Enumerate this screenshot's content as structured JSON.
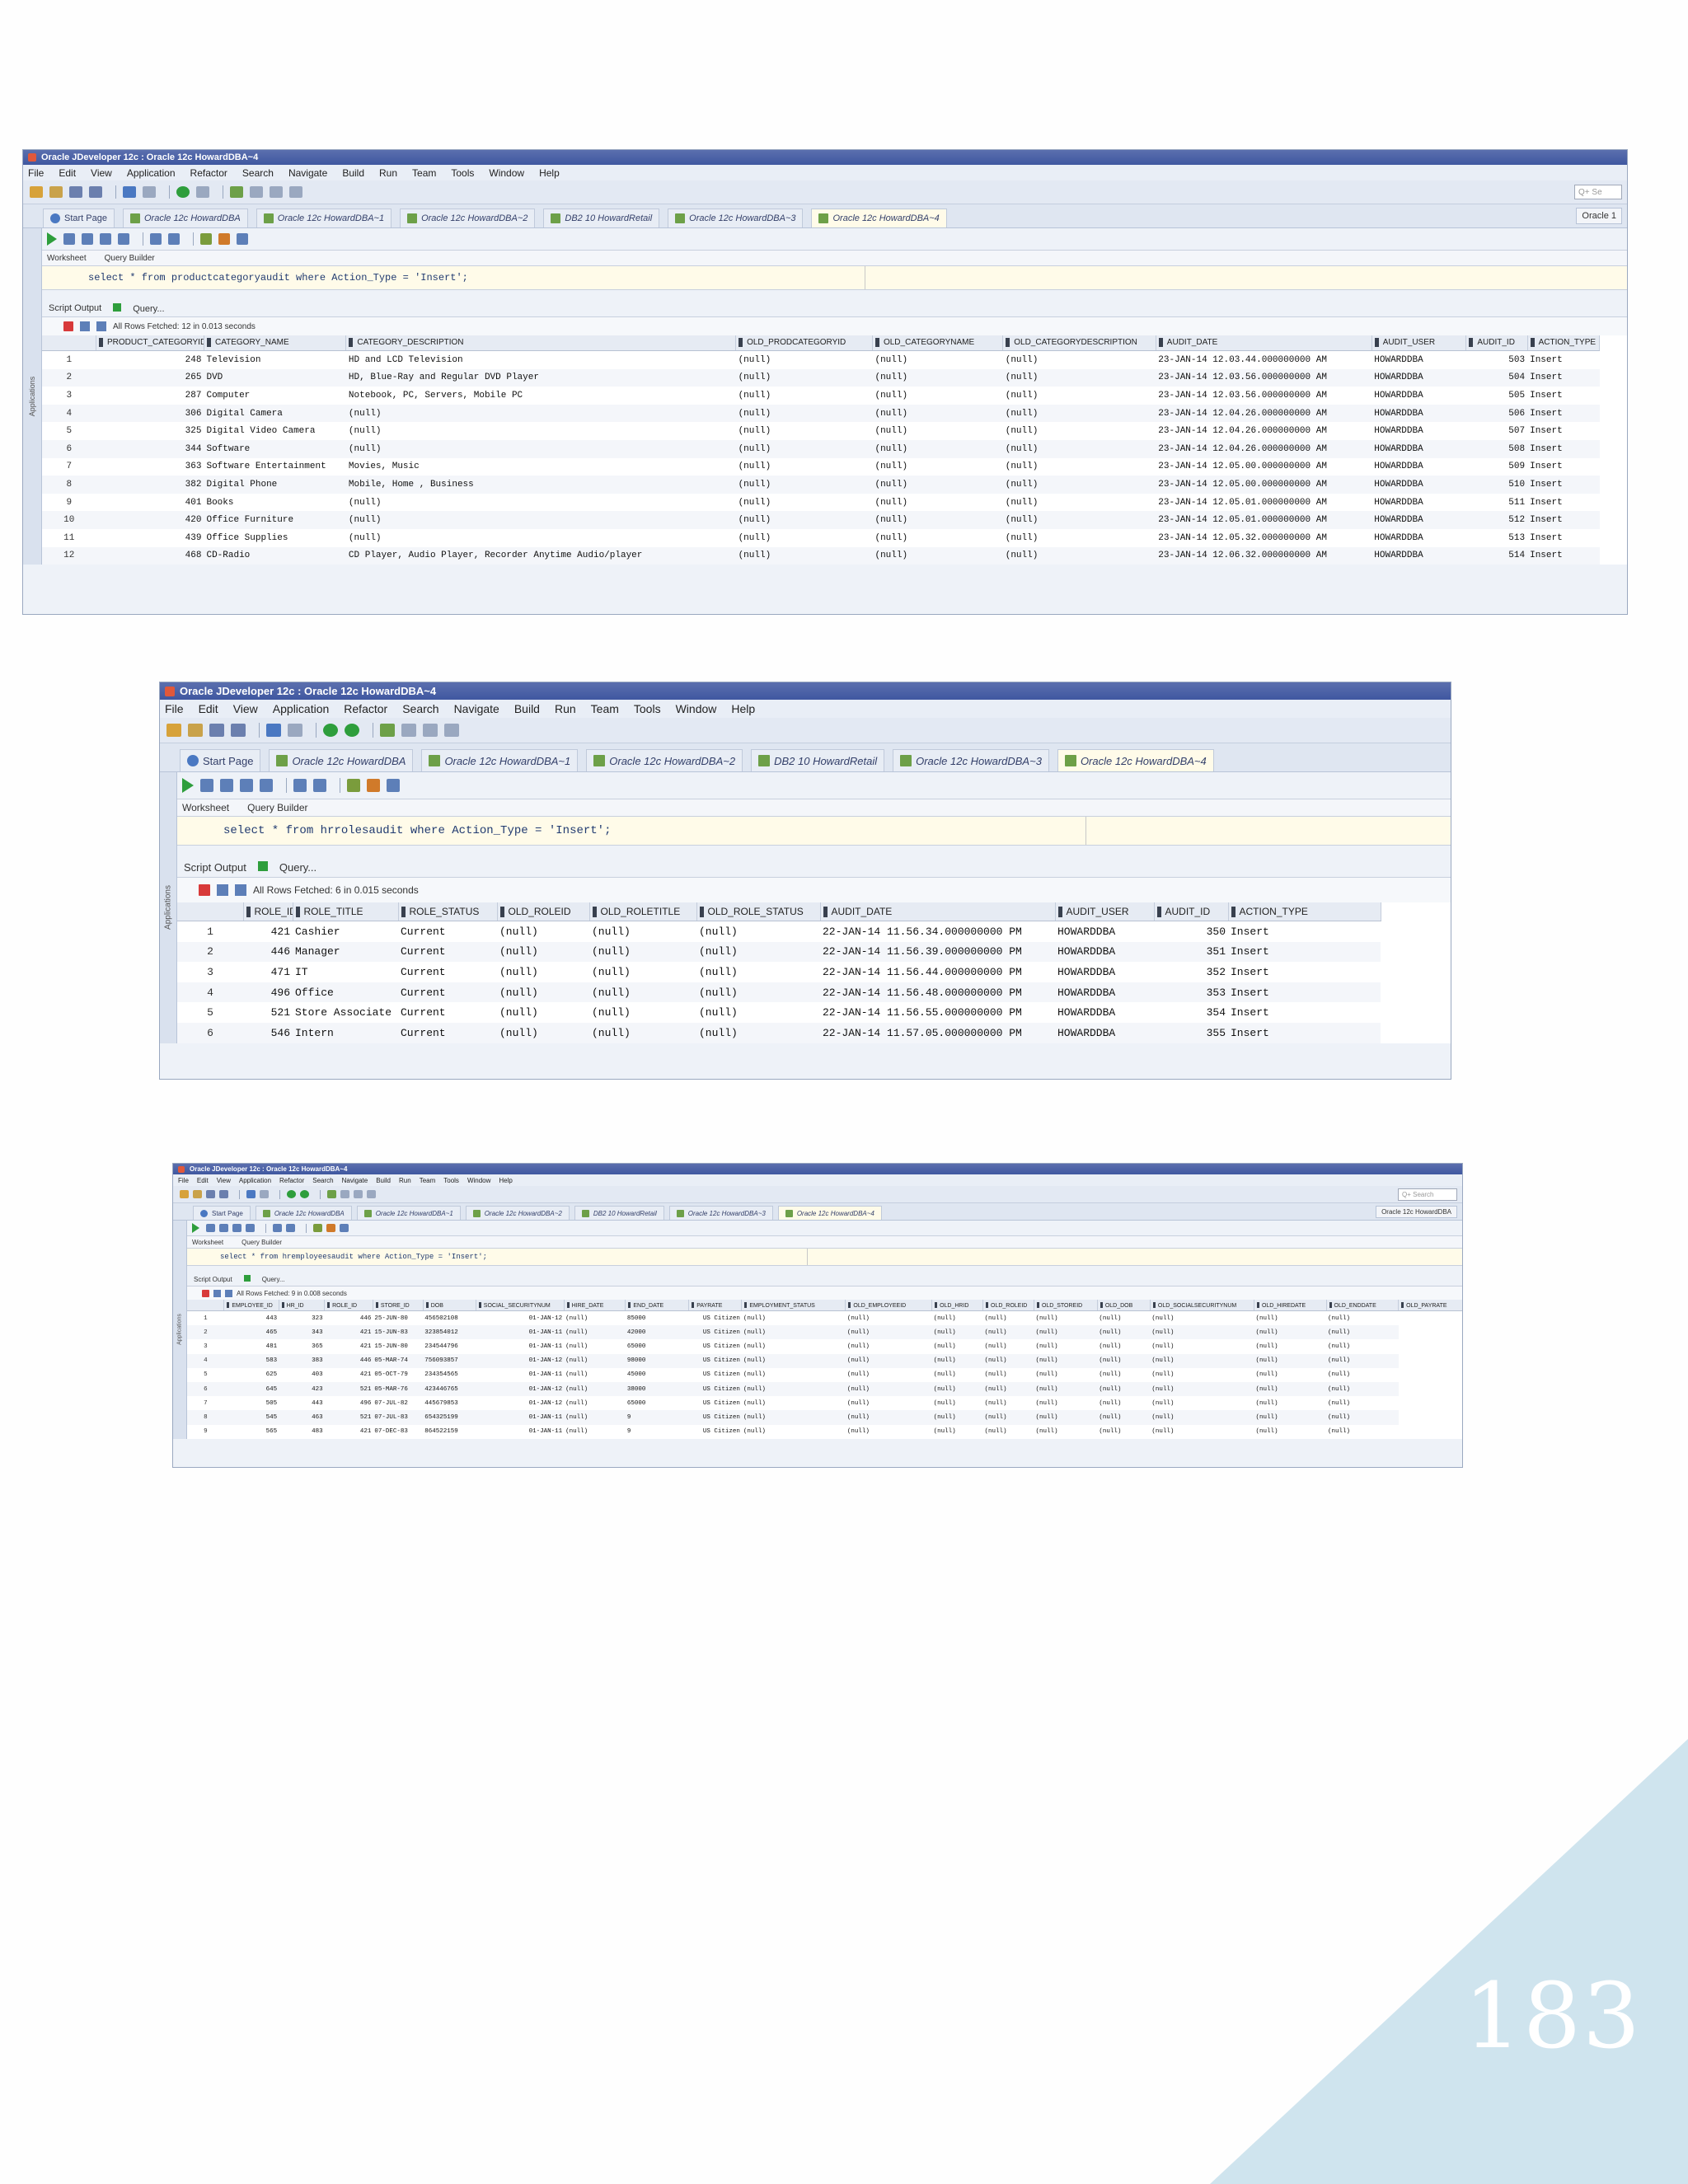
{
  "page": {
    "number": "183",
    "corner_color": "#cfe4ee"
  },
  "colors": {
    "title_bar": "#3f57a0",
    "editor_bg": "#fffbe9",
    "grid_header": "#e6ebf3",
    "run_green": "#2e9e3c",
    "pin_red": "#d83a3a"
  },
  "icons": [
    "app-icon",
    "run-statement-icon",
    "run-script-icon",
    "pin-icon",
    "sql-icon",
    "connection-icon",
    "start-page-icon"
  ],
  "menu": [
    "File",
    "Edit",
    "View",
    "Application",
    "Refactor",
    "Search",
    "Navigate",
    "Build",
    "Run",
    "Team",
    "Tools",
    "Window",
    "Help"
  ],
  "tabs": [
    "Start Page",
    "Oracle 12c HowardDBA",
    "Oracle 12c HowardDBA~1",
    "Oracle 12c HowardDBA~2",
    "DB2 10 HowardRetail",
    "Oracle 12c HowardDBA~3",
    "Oracle 12c HowardDBA~4"
  ],
  "worksheet_tabs": {
    "worksheet": "Worksheet",
    "query_builder": "Query Builder"
  },
  "results_tabs": {
    "script_output": "Script Output",
    "query_result": "Query..."
  },
  "sidebar_label": "Applications",
  "screenshot1": {
    "title": "Oracle JDeveloper 12c : Oracle 12c HowardDBA~4",
    "search_placeholder": "Q+ Se",
    "right_tab": "Oracle 1",
    "sql": "select * from productcategoryaudit where Action_Type = 'Insert';",
    "fetch_status": "All Rows Fetched: 12 in 0.013 seconds",
    "columns": [
      "PRODUCT_CATEGORYID",
      "CATEGORY_NAME",
      "CATEGORY_DESCRIPTION",
      "OLD_PRODCATEGORYID",
      "OLD_CATEGORYNAME",
      "OLD_CATEGORYDESCRIPTION",
      "AUDIT_DATE",
      "AUDIT_USER",
      "AUDIT_ID",
      "ACTION_TYPE"
    ],
    "rows": [
      [
        "1",
        "248",
        "Television",
        "HD and LCD Television",
        "(null)",
        "(null)",
        "(null)",
        "23-JAN-14 12.03.44.000000000 AM",
        "HOWARDDBA",
        "503",
        "Insert"
      ],
      [
        "2",
        "265",
        "DVD",
        "HD, Blue-Ray and Regular DVD Player",
        "(null)",
        "(null)",
        "(null)",
        "23-JAN-14 12.03.56.000000000 AM",
        "HOWARDDBA",
        "504",
        "Insert"
      ],
      [
        "3",
        "287",
        "Computer",
        "Notebook, PC, Servers, Mobile PC",
        "(null)",
        "(null)",
        "(null)",
        "23-JAN-14 12.03.56.000000000 AM",
        "HOWARDDBA",
        "505",
        "Insert"
      ],
      [
        "4",
        "306",
        "Digital Camera",
        "(null)",
        "(null)",
        "(null)",
        "(null)",
        "23-JAN-14 12.04.26.000000000 AM",
        "HOWARDDBA",
        "506",
        "Insert"
      ],
      [
        "5",
        "325",
        "Digital Video Camera",
        "(null)",
        "(null)",
        "(null)",
        "(null)",
        "23-JAN-14 12.04.26.000000000 AM",
        "HOWARDDBA",
        "507",
        "Insert"
      ],
      [
        "6",
        "344",
        "Software",
        "(null)",
        "(null)",
        "(null)",
        "(null)",
        "23-JAN-14 12.04.26.000000000 AM",
        "HOWARDDBA",
        "508",
        "Insert"
      ],
      [
        "7",
        "363",
        "Software Entertainment",
        "Movies, Music",
        "(null)",
        "(null)",
        "(null)",
        "23-JAN-14 12.05.00.000000000 AM",
        "HOWARDDBA",
        "509",
        "Insert"
      ],
      [
        "8",
        "382",
        "Digital Phone",
        "Mobile, Home , Business",
        "(null)",
        "(null)",
        "(null)",
        "23-JAN-14 12.05.00.000000000 AM",
        "HOWARDDBA",
        "510",
        "Insert"
      ],
      [
        "9",
        "401",
        "Books",
        "(null)",
        "(null)",
        "(null)",
        "(null)",
        "23-JAN-14 12.05.01.000000000 AM",
        "HOWARDDBA",
        "511",
        "Insert"
      ],
      [
        "10",
        "420",
        "Office Furniture",
        "(null)",
        "(null)",
        "(null)",
        "(null)",
        "23-JAN-14 12.05.01.000000000 AM",
        "HOWARDDBA",
        "512",
        "Insert"
      ],
      [
        "11",
        "439",
        "Office Supplies",
        "(null)",
        "(null)",
        "(null)",
        "(null)",
        "23-JAN-14 12.05.32.000000000 AM",
        "HOWARDDBA",
        "513",
        "Insert"
      ],
      [
        "12",
        "468",
        "CD-Radio",
        "CD Player, Audio Player, Recorder  Anytime Audio/player",
        "(null)",
        "(null)",
        "(null)",
        "23-JAN-14 12.06.32.000000000 AM",
        "HOWARDDBA",
        "514",
        "Insert"
      ]
    ]
  },
  "screenshot2": {
    "title": "Oracle JDeveloper 12c : Oracle 12c HowardDBA~4",
    "sql": "select * from hrrolesaudit where Action_Type = 'Insert';",
    "fetch_status": "All Rows Fetched: 6 in 0.015 seconds",
    "columns": [
      "ROLE_ID",
      "ROLE_TITLE",
      "ROLE_STATUS",
      "OLD_ROLEID",
      "OLD_ROLETITLE",
      "OLD_ROLE_STATUS",
      "AUDIT_DATE",
      "AUDIT_USER",
      "AUDIT_ID",
      "ACTION_TYPE"
    ],
    "rows": [
      [
        "1",
        "421",
        "Cashier",
        "Current",
        "(null)",
        "(null)",
        "(null)",
        "22-JAN-14 11.56.34.000000000 PM",
        "HOWARDDBA",
        "350",
        "Insert"
      ],
      [
        "2",
        "446",
        "Manager",
        "Current",
        "(null)",
        "(null)",
        "(null)",
        "22-JAN-14 11.56.39.000000000 PM",
        "HOWARDDBA",
        "351",
        "Insert"
      ],
      [
        "3",
        "471",
        "IT",
        "Current",
        "(null)",
        "(null)",
        "(null)",
        "22-JAN-14 11.56.44.000000000 PM",
        "HOWARDDBA",
        "352",
        "Insert"
      ],
      [
        "4",
        "496",
        "Office",
        "Current",
        "(null)",
        "(null)",
        "(null)",
        "22-JAN-14 11.56.48.000000000 PM",
        "HOWARDDBA",
        "353",
        "Insert"
      ],
      [
        "5",
        "521",
        "Store Associate",
        "Current",
        "(null)",
        "(null)",
        "(null)",
        "22-JAN-14 11.56.55.000000000 PM",
        "HOWARDDBA",
        "354",
        "Insert"
      ],
      [
        "6",
        "546",
        "Intern",
        "Current",
        "(null)",
        "(null)",
        "(null)",
        "22-JAN-14 11.57.05.000000000 PM",
        "HOWARDDBA",
        "355",
        "Insert"
      ]
    ]
  },
  "screenshot3": {
    "title": "Oracle JDeveloper 12c : Oracle 12c HowardDBA~4",
    "search_placeholder": "Q+ Search",
    "right_tab": "Oracle 12c HowardDBA",
    "sql": "select * from hremployeesaudit where Action_Type = 'Insert';",
    "fetch_status": "All Rows Fetched: 9 in 0.008 seconds",
    "columns": [
      "EMPLOYEE_ID",
      "HR_ID",
      "ROLE_ID",
      "STORE_ID",
      "DOB",
      "SOCIAL_SECURITYNUM",
      "HIRE_DATE",
      "END_DATE",
      "PAYRATE",
      "EMPLOYMENT_STATUS",
      "OLD_EMPLOYEEID",
      "OLD_HRID",
      "OLD_ROLEID",
      "OLD_STOREID",
      "OLD_DOB",
      "OLD_SOCIALSECURITYNUM",
      "OLD_HIREDATE",
      "OLD_ENDDATE",
      "OLD_PAYRATE"
    ],
    "rows": [
      [
        "1",
        "443",
        "323",
        "446",
        "25-JUN-80",
        "456502108",
        "01-JAN-12",
        "(null)",
        "85000",
        "US Citizen",
        "(null)",
        "(null)",
        "(null)",
        "(null)",
        "(null)",
        "(null)",
        "(null)",
        "(null)",
        "(null)"
      ],
      [
        "2",
        "465",
        "343",
        "421",
        "15-JUN-83",
        "323854012",
        "01-JAN-11",
        "(null)",
        "42000",
        "US Citizen",
        "(null)",
        "(null)",
        "(null)",
        "(null)",
        "(null)",
        "(null)",
        "(null)",
        "(null)",
        "(null)"
      ],
      [
        "3",
        "481",
        "365",
        "421",
        "15-JUN-80",
        "234544796",
        "01-JAN-11",
        "(null)",
        "65000",
        "US Citizen",
        "(null)",
        "(null)",
        "(null)",
        "(null)",
        "(null)",
        "(null)",
        "(null)",
        "(null)",
        "(null)"
      ],
      [
        "4",
        "583",
        "383",
        "446",
        "05-MAR-74",
        "756093857",
        "01-JAN-12",
        "(null)",
        "98000",
        "US Citizen",
        "(null)",
        "(null)",
        "(null)",
        "(null)",
        "(null)",
        "(null)",
        "(null)",
        "(null)",
        "(null)"
      ],
      [
        "5",
        "625",
        "403",
        "421",
        "05-OCT-79",
        "234354565",
        "01-JAN-11",
        "(null)",
        "45000",
        "US Citizen",
        "(null)",
        "(null)",
        "(null)",
        "(null)",
        "(null)",
        "(null)",
        "(null)",
        "(null)",
        "(null)"
      ],
      [
        "6",
        "645",
        "423",
        "521",
        "05-MAR-76",
        "423446765",
        "01-JAN-12",
        "(null)",
        "38000",
        "US Citizen",
        "(null)",
        "(null)",
        "(null)",
        "(null)",
        "(null)",
        "(null)",
        "(null)",
        "(null)",
        "(null)"
      ],
      [
        "7",
        "505",
        "443",
        "496",
        "07-JUL-82",
        "445679853",
        "01-JAN-12",
        "(null)",
        "65000",
        "US Citizen",
        "(null)",
        "(null)",
        "(null)",
        "(null)",
        "(null)",
        "(null)",
        "(null)",
        "(null)",
        "(null)"
      ],
      [
        "8",
        "545",
        "463",
        "521",
        "07-JUL-83",
        "654325199",
        "01-JAN-11",
        "(null)",
        "9",
        "US Citizen",
        "(null)",
        "(null)",
        "(null)",
        "(null)",
        "(null)",
        "(null)",
        "(null)",
        "(null)",
        "(null)"
      ],
      [
        "9",
        "565",
        "483",
        "421",
        "07-DEC-83",
        "864522159",
        "01-JAN-11",
        "(null)",
        "9",
        "US Citizen",
        "(null)",
        "(null)",
        "(null)",
        "(null)",
        "(null)",
        "(null)",
        "(null)",
        "(null)",
        "(null)"
      ]
    ]
  }
}
